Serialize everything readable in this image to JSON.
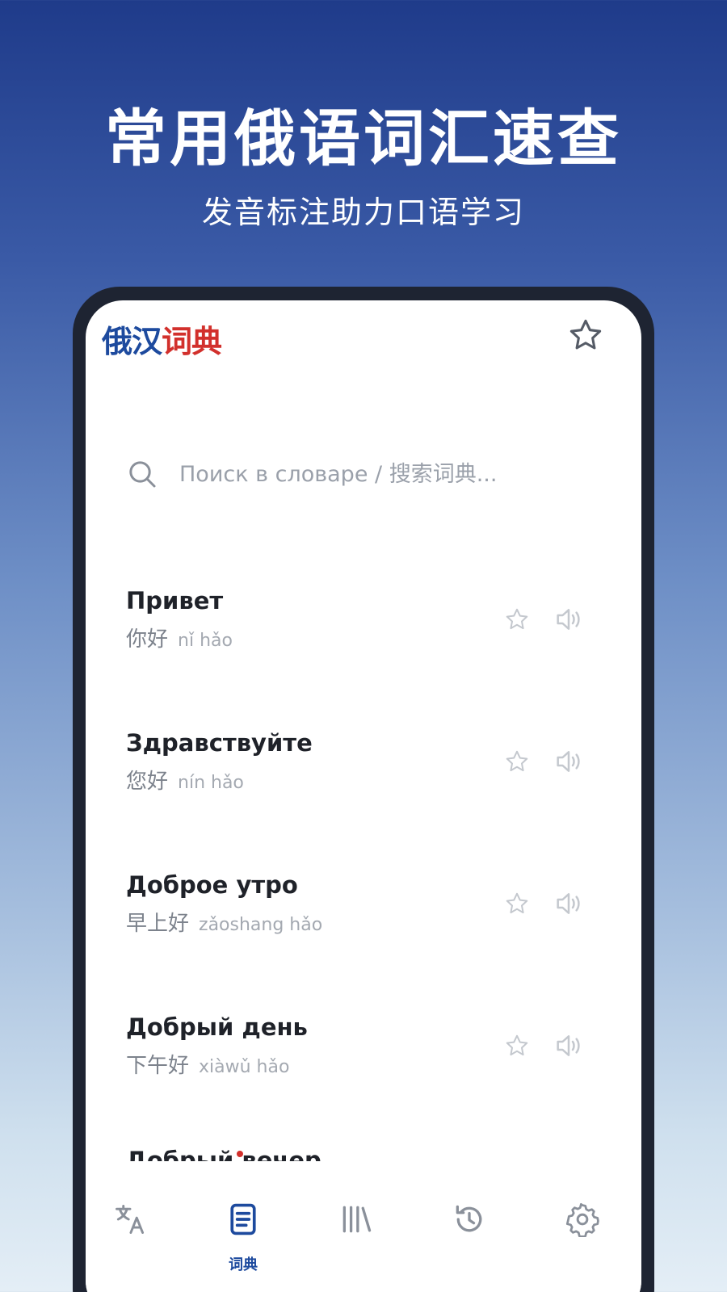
{
  "promo": {
    "headline": "常用俄语词汇速查",
    "subline": "发音标注助力口语学习"
  },
  "app": {
    "logo_part1": "俄汉",
    "logo_part2": "词典",
    "favorites_icon": "star-icon"
  },
  "search": {
    "placeholder": "Поиск в словаре / 搜索词典..."
  },
  "words": [
    {
      "ru": "Привет",
      "zh": "你好",
      "pinyin": "nǐ hǎo"
    },
    {
      "ru": "Здравствуйте",
      "zh": "您好",
      "pinyin": "nín hǎo"
    },
    {
      "ru": "Доброе утро",
      "zh": "早上好",
      "pinyin": "zǎoshang hǎo"
    },
    {
      "ru": "Добрый день",
      "zh": "下午好",
      "pinyin": "xiàwǔ hǎo"
    }
  ],
  "partial_word": "Добрый вечер",
  "nav": {
    "items": [
      {
        "icon": "translate-icon",
        "label": ""
      },
      {
        "icon": "dictionary-icon",
        "label": "词典",
        "active": true
      },
      {
        "icon": "library-icon",
        "label": ""
      },
      {
        "icon": "history-icon",
        "label": ""
      },
      {
        "icon": "settings-icon",
        "label": ""
      }
    ]
  },
  "colors": {
    "brand_blue": "#1d4a9e",
    "brand_red": "#d2302c",
    "icon_gray": "#c4c8ce"
  }
}
